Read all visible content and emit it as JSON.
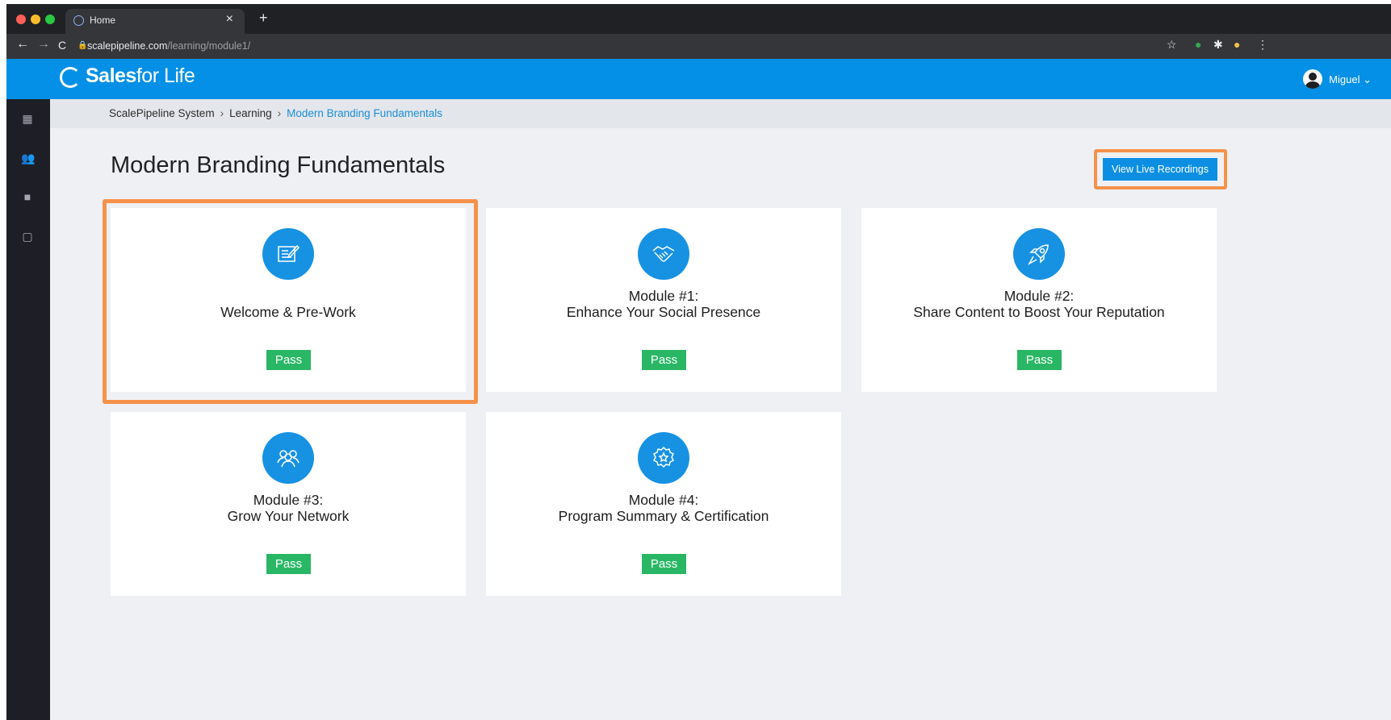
{
  "browser": {
    "tab_title": "Home",
    "tab_close": "×",
    "new_tab": "+",
    "url_domain": "scalepipeline.com",
    "url_path": "/learning/module1/"
  },
  "header": {
    "logo_bold": "Sales",
    "logo_thin": "for Life",
    "user_name": "Miguel",
    "user_caret": "⌄"
  },
  "breadcrumb": {
    "items": [
      "ScalePipeline System",
      "Learning"
    ],
    "separator": "›",
    "current": "Modern Branding Fundamentals"
  },
  "page": {
    "title": "Modern Branding Fundamentals",
    "live_button": "View Live Recordings"
  },
  "cards": [
    {
      "line1": "",
      "line2": "Welcome & Pre-Work",
      "status": "Pass",
      "icon": "edit-document-icon"
    },
    {
      "line1": "Module #1:",
      "line2": "Enhance Your Social Presence",
      "status": "Pass",
      "icon": "handshake-icon"
    },
    {
      "line1": "Module #2:",
      "line2": "Share Content to Boost Your Reputation",
      "status": "Pass",
      "icon": "rocket-icon"
    },
    {
      "line1": "Module #3:",
      "line2": "Grow Your Network",
      "status": "Pass",
      "icon": "people-group-icon"
    },
    {
      "line1": "Module #4:",
      "line2": "Program Summary & Certification",
      "status": "Pass",
      "icon": "award-badge-icon"
    }
  ],
  "colors": {
    "brand_blue": "#0390e6",
    "pass_green": "#2ab765",
    "highlight_orange": "#f5924a"
  }
}
